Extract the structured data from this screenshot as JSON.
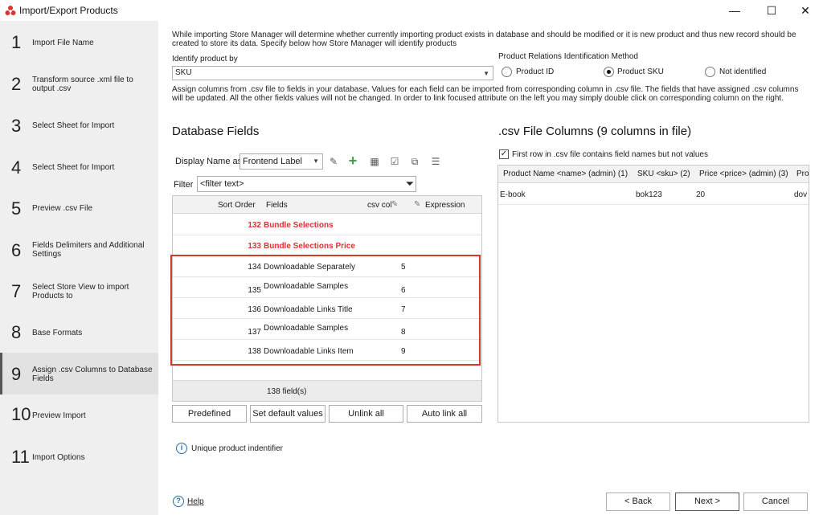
{
  "window": {
    "title": "Import/Export Products",
    "minimize": "—",
    "maximize": "☐",
    "close": "✕"
  },
  "sidebar": {
    "steps": [
      {
        "num": "1",
        "label": "Import File Name"
      },
      {
        "num": "2",
        "label": "Transform source .xml file to output .csv"
      },
      {
        "num": "3",
        "label": "Select Sheet for Import"
      },
      {
        "num": "4",
        "label": "Select Sheet for Import"
      },
      {
        "num": "5",
        "label": "Preview .csv File"
      },
      {
        "num": "6",
        "label": "Fields Delimiters and Additional Settings"
      },
      {
        "num": "7",
        "label": "Select Store View to import Products to"
      },
      {
        "num": "8",
        "label": "Base Formats"
      },
      {
        "num": "9",
        "label": "Assign .csv Columns to Database Fields"
      },
      {
        "num": "10",
        "label": "Preview Import"
      },
      {
        "num": "11",
        "label": "Import Options"
      }
    ]
  },
  "intro": "While importing Store Manager will determine whether currently importing product exists in database and should be modified or it is new product and thus new record should be created to store its data. Specify below how Store Manager will identify products",
  "identify": {
    "label": "Identify product by",
    "value": "SKU"
  },
  "relations": {
    "label": "Product Relations Identification Method",
    "options": [
      "Product ID",
      "Product SKU",
      "Not identified"
    ],
    "selected": "Product SKU"
  },
  "assign_text": "Assign columns from .csv file to fields in your database. Values for each field can be imported from corresponding column in .csv file. The fields that have assigned .csv columns will be updated. All the other fields values will not be changed. In order to link focused attribute on the left you may simply double click on corresponding column on the right.",
  "db": {
    "title": "Database Fields",
    "display_name_label": "Display Name as",
    "display_name_value": "Frontend Label",
    "filter_label": "Filter",
    "filter_placeholder": "<filter text>",
    "columns": {
      "sort_order": "Sort Order",
      "fields": "Fields",
      "csv_col": "csv col",
      "expression": "Expression"
    },
    "rows": [
      {
        "sort": "132",
        "field": "Bundle Selections",
        "csv": "",
        "highlight": true
      },
      {
        "sort": "133",
        "field": "Bundle Selections Price",
        "csv": "",
        "highlight": true
      },
      {
        "sort": "134",
        "field": "Downloadable Separately",
        "csv": "5",
        "highlight": false
      },
      {
        "sort": "135",
        "field": "Downloadable Samples",
        "csv": "6",
        "highlight": false
      },
      {
        "sort": "136",
        "field": "Downloadable Links Title",
        "csv": "7",
        "highlight": false
      },
      {
        "sort": "137",
        "field": "Downloadable Samples",
        "csv": "8",
        "highlight": false
      },
      {
        "sort": "138",
        "field": "Downloadable Links Item",
        "csv": "9",
        "highlight": false
      }
    ],
    "footer": "138 field(s)"
  },
  "buttons": {
    "predefined": "Predefined",
    "set_default": "Set default values",
    "unlink_all": "Unlink all",
    "auto_link_all": "Auto link all"
  },
  "csv": {
    "title": ".csv File Columns (9 columns in file)",
    "first_row_label": "First row in .csv file contains field names but not values",
    "first_row_checked": true,
    "columns": [
      "Product Name <name> (admin) (1)",
      "SKU <sku> (2)",
      "Price <price> (admin) (3)",
      "Pro"
    ],
    "row": [
      "E-book",
      "bok123",
      "20",
      "dov"
    ]
  },
  "unique_identifier": "Unique product indentifier",
  "footer": {
    "help": "Help",
    "back": "< Back",
    "next": "Next >",
    "cancel": "Cancel"
  },
  "colors": {
    "highlight_border": "#d9352e",
    "highlight_text": "#d9352e",
    "add_icon": "#3aa34a",
    "info_icon": "#1f6fb2"
  }
}
